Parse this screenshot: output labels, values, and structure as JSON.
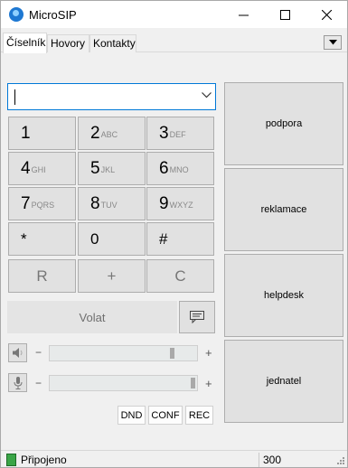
{
  "window": {
    "title": "MicroSIP"
  },
  "tabs": [
    {
      "label": "Číselník",
      "active": true
    },
    {
      "label": "Hovory",
      "active": false
    },
    {
      "label": "Kontakty",
      "active": false
    }
  ],
  "dialer": {
    "input_value": "",
    "keys": [
      {
        "digit": "1",
        "letters": ""
      },
      {
        "digit": "2",
        "letters": "ABC"
      },
      {
        "digit": "3",
        "letters": "DEF"
      },
      {
        "digit": "4",
        "letters": "GHI"
      },
      {
        "digit": "5",
        "letters": "JKL"
      },
      {
        "digit": "6",
        "letters": "MNO"
      },
      {
        "digit": "7",
        "letters": "PQRS"
      },
      {
        "digit": "8",
        "letters": "TUV"
      },
      {
        "digit": "9",
        "letters": "WXYZ"
      },
      {
        "digit": "*",
        "letters": ""
      },
      {
        "digit": "0",
        "letters": ""
      },
      {
        "digit": "#",
        "letters": ""
      }
    ],
    "function_keys": [
      "R",
      "+",
      "C"
    ],
    "call_label": "Volat"
  },
  "audio": {
    "speaker": {
      "minus": "−",
      "plus": "+",
      "level": 0.85
    },
    "microphone": {
      "minus": "−",
      "plus": "+",
      "level": 1.0
    }
  },
  "toggles": {
    "dnd": "DND",
    "conf": "CONF",
    "rec": "REC"
  },
  "speed_dial": [
    "podpora",
    "reklamace",
    "helpdesk",
    "jednatel"
  ],
  "status": {
    "text": "Připojeno",
    "count": "300"
  }
}
